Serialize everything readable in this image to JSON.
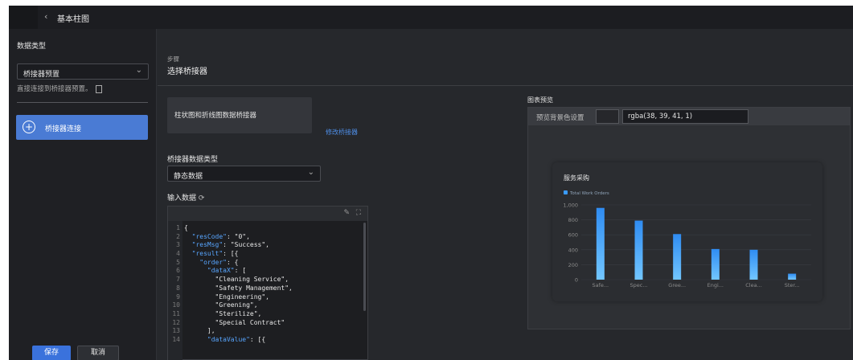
{
  "topbar": {
    "back_icon": "‹",
    "title": "基本柱图"
  },
  "sidebar": {
    "data_type_label": "数据类型",
    "data_type_value": "桥接器预置",
    "hint": "直接连接到桥接器预置。",
    "connect_button": "桥接器连接",
    "save": "保存",
    "cancel": "取消"
  },
  "main": {
    "step_label": "步骤",
    "step_value": "选择桥接器",
    "card_text": "柱状图和折线图数据桥接器",
    "modify_link": "修改桥接器",
    "bridge_type_label": "桥接器数据类型",
    "bridge_type_value": "静态数据",
    "input_label": "输入数据",
    "code_lines": [
      {
        "n": "1",
        "pre": "{",
        "key": "",
        "post": ""
      },
      {
        "n": "2",
        "pre": "  ",
        "key": "\"resCode\"",
        "post": ": \"0\","
      },
      {
        "n": "3",
        "pre": "  ",
        "key": "\"resMsg\"",
        "post": ": \"Success\","
      },
      {
        "n": "4",
        "pre": "  ",
        "key": "\"result\"",
        "post": ": [{"
      },
      {
        "n": "5",
        "pre": "    ",
        "key": "\"order\"",
        "post": ": {"
      },
      {
        "n": "6",
        "pre": "      ",
        "key": "\"dataX\"",
        "post": ": ["
      },
      {
        "n": "7",
        "pre": "        \"Cleaning Service\",",
        "key": "",
        "post": ""
      },
      {
        "n": "8",
        "pre": "        \"Safety Management\",",
        "key": "",
        "post": ""
      },
      {
        "n": "9",
        "pre": "        \"Engineering\",",
        "key": "",
        "post": ""
      },
      {
        "n": "10",
        "pre": "        \"Greening\",",
        "key": "",
        "post": ""
      },
      {
        "n": "11",
        "pre": "        \"Sterilize\",",
        "key": "",
        "post": ""
      },
      {
        "n": "12",
        "pre": "        \"Special Contract\"",
        "key": "",
        "post": ""
      },
      {
        "n": "13",
        "pre": "      ],",
        "key": "",
        "post": ""
      },
      {
        "n": "14",
        "pre": "      ",
        "key": "\"dataValue\"",
        "post": ": [{"
      }
    ]
  },
  "preview": {
    "label": "图表预览",
    "bg_label": "预览背景色设置",
    "bg_value": "rgba(38, 39, 41, 1)"
  },
  "chart_data": {
    "type": "bar",
    "title": "服务采购",
    "categories": [
      "Safe...",
      "Spec...",
      "Gree...",
      "Engi...",
      "Clea...",
      "Ster..."
    ],
    "series": [
      {
        "name": "Total Work Orders",
        "values": [
          960,
          790,
          610,
          410,
          400,
          80
        ]
      }
    ],
    "ylim": [
      0,
      1000
    ],
    "yticks": [
      "0",
      "200",
      "400",
      "600",
      "800",
      "1,000"
    ],
    "legend": "top-left",
    "grid": true,
    "colors": {
      "bar_top": "#2f8cf2",
      "bar_bottom": "#72c6ff",
      "legend": "#3a9bff"
    }
  }
}
